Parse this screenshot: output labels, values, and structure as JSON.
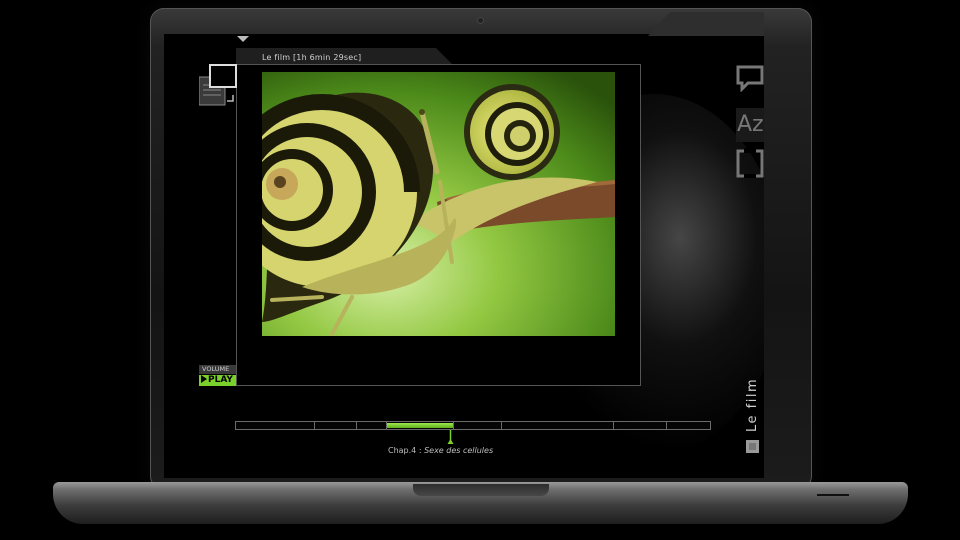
{
  "player": {
    "title": "Le film [1h 6min 29sec]",
    "volume_label": "VOLUME",
    "play_label": "PLAY"
  },
  "sidebar_right": {
    "comment_icon": "speech-bubble-icon",
    "glossary_label": "Az",
    "fullscreen_icon": "frame-icon",
    "vertical_title": "Le film",
    "stop_icon": "stop-icon"
  },
  "timeline": {
    "chapter_count": 8,
    "active_chapter": 4,
    "chapter_prefix": "Chap.4 : ",
    "chapter_title": "Sexe des cellules",
    "accent_color": "#7bd12b"
  },
  "colors": {
    "accent": "#7bd12b",
    "text": "#cfcfcf",
    "background": "#000000"
  }
}
